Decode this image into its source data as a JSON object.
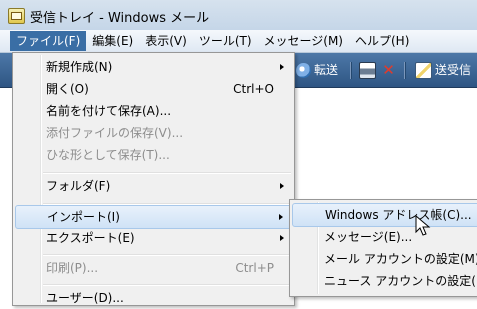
{
  "window": {
    "title": "受信トレイ - Windows メール"
  },
  "menubar": {
    "items": [
      {
        "label": "ファイル(F)"
      },
      {
        "label": "編集(E)"
      },
      {
        "label": "表示(V)"
      },
      {
        "label": "ツール(T)"
      },
      {
        "label": "メッセージ(M)"
      },
      {
        "label": "ヘルプ(H)"
      }
    ]
  },
  "toolbar": {
    "forward_label": "転送",
    "sendrecv_label": "送受信"
  },
  "file_menu": {
    "items": [
      {
        "label": "新規作成(N)",
        "shortcut": "",
        "submenu": true,
        "disabled": false
      },
      {
        "label": "開く(O)",
        "shortcut": "Ctrl+O",
        "submenu": false,
        "disabled": false
      },
      {
        "label": "名前を付けて保存(A)...",
        "shortcut": "",
        "submenu": false,
        "disabled": false
      },
      {
        "label": "添付ファイルの保存(V)...",
        "shortcut": "",
        "submenu": false,
        "disabled": true
      },
      {
        "label": "ひな形として保存(T)...",
        "shortcut": "",
        "submenu": false,
        "disabled": true
      },
      {
        "label": "フォルダ(F)",
        "shortcut": "",
        "submenu": true,
        "disabled": false
      },
      {
        "label": "インポート(I)",
        "shortcut": "",
        "submenu": true,
        "disabled": false
      },
      {
        "label": "エクスポート(E)",
        "shortcut": "",
        "submenu": true,
        "disabled": false
      },
      {
        "label": "印刷(P)...",
        "shortcut": "Ctrl+P",
        "submenu": false,
        "disabled": true
      },
      {
        "label": "ユーザー(D)...",
        "shortcut": "",
        "submenu": false,
        "disabled": false
      }
    ]
  },
  "import_submenu": {
    "items": [
      {
        "label": "Windows アドレス帳(C)..."
      },
      {
        "label": "メッセージ(E)..."
      },
      {
        "label": "メール アカウントの設定(M)..."
      },
      {
        "label": "ニュース アカウントの設定(N)..."
      }
    ]
  }
}
